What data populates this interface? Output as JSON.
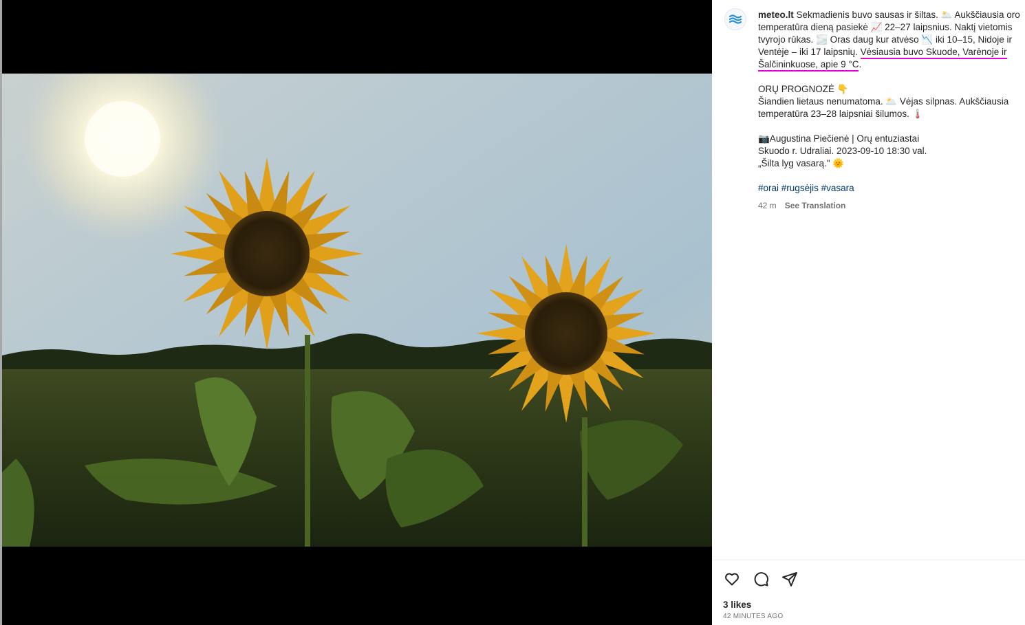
{
  "post": {
    "username": "meteo.lt",
    "caption": {
      "p1_intro": " Sekmadienis buvo sausas ir šiltas. 🌥️ Aukščiausia oro temperatūra dieną pasiekė 📈 22–27 laipsnius. Naktį vietomis tvyrojo rūkas. 🌫️ Oras daug kur atvėso 📉 iki 10–15, Nidoje ir Ventėje – iki 17 laipsnių. ",
      "p1_highlight": "Vėsiausia buvo Skuode, Varėnoje ir Šalčininkuose, apie 9 °C",
      "p1_end": ".",
      "p2_heading": "ORŲ PROGNOZĖ 👇",
      "p2_body": "Šiandien lietaus nenumatoma. 🌥️ Vėjas silpnas. Aukščiausia temperatūra 23–28 laipsniai šilumos. 🌡️",
      "p3_credit": "📷Augustina Piečienė | Orų entuziastai",
      "p3_place": "Skuodo r. Udraliai. 2023-09-10 18:30 val.",
      "p3_quote": "„Šilta lyg vasarą.\" 🌞",
      "hashtags": [
        "#orai",
        "#rugsėjis",
        "#vasara"
      ]
    },
    "time_ago": "42 m",
    "see_translation": "See Translation",
    "likes": "3 likes",
    "timestamp": "42 MINUTES AGO"
  },
  "icons": {
    "avatar": "meteo-logo-icon",
    "like": "heart-icon",
    "comment": "comment-icon",
    "share": "share-icon"
  },
  "colors": {
    "highlight": "#e600d6",
    "hashtag": "#00376b",
    "muted": "#737373",
    "logo": "#2b8fd6"
  }
}
